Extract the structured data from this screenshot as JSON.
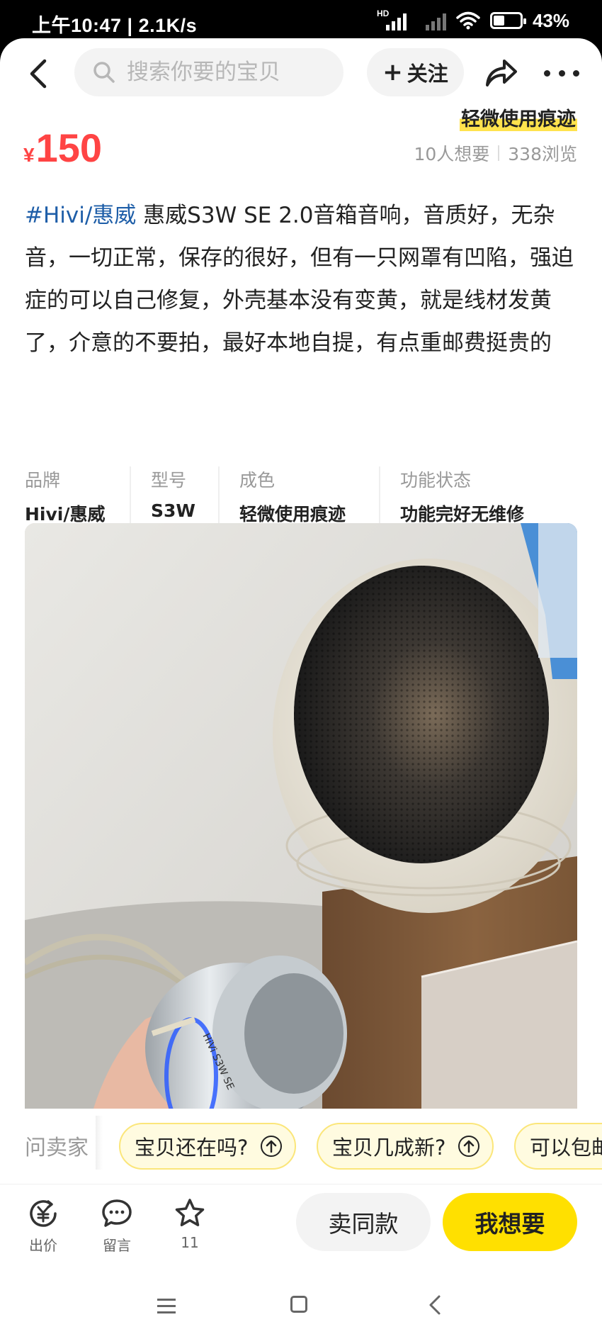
{
  "status_bar": {
    "time_speed": "上午10:47 | 2.1K/s",
    "signal_tag": "HD",
    "battery": "43%",
    "battery_fraction": 0.43
  },
  "nav": {
    "search_placeholder": "搜索你要的宝贝",
    "follow_label": "关注",
    "follow_plus": "+"
  },
  "item": {
    "condition_tag": "轻微使用痕迹",
    "price_currency": "¥",
    "price": "150",
    "want_count": "10人想要",
    "view_count": "338浏览",
    "brand_hashtag": "#Hivi/惠威",
    "description": " 惠威S3W SE 2.0音箱音响，音质好，无杂音，一切正常，保存的很好，但有一只网罩有凹陷，强迫症的可以自己修复，外壳基本没有变黄，就是线材发黄了，介意的不要拍，最好本地自提，有点重邮费挺贵的"
  },
  "params": [
    {
      "key": "品牌",
      "value": "Hivi/惠威"
    },
    {
      "key": "型号",
      "value": "S3W"
    },
    {
      "key": "成色",
      "value": "轻微使用痕迹"
    },
    {
      "key": "功能状态",
      "value": "功能完好无维修"
    }
  ],
  "photo": {
    "label_text": "HiVi S3W SE"
  },
  "quick_questions": {
    "ask_label": "问卖家",
    "chips": [
      "宝贝还在吗?",
      "宝贝几成新?",
      "可以包邮"
    ]
  },
  "bottom_bar": {
    "offer_label": "出价",
    "comment_label": "留言",
    "fav_count": "11",
    "same_label": "卖同款",
    "want_label": "我想要"
  },
  "colors": {
    "price_red": "#ff4444",
    "brand_yellow": "#ffe000",
    "link_blue": "#1e5ea8"
  }
}
